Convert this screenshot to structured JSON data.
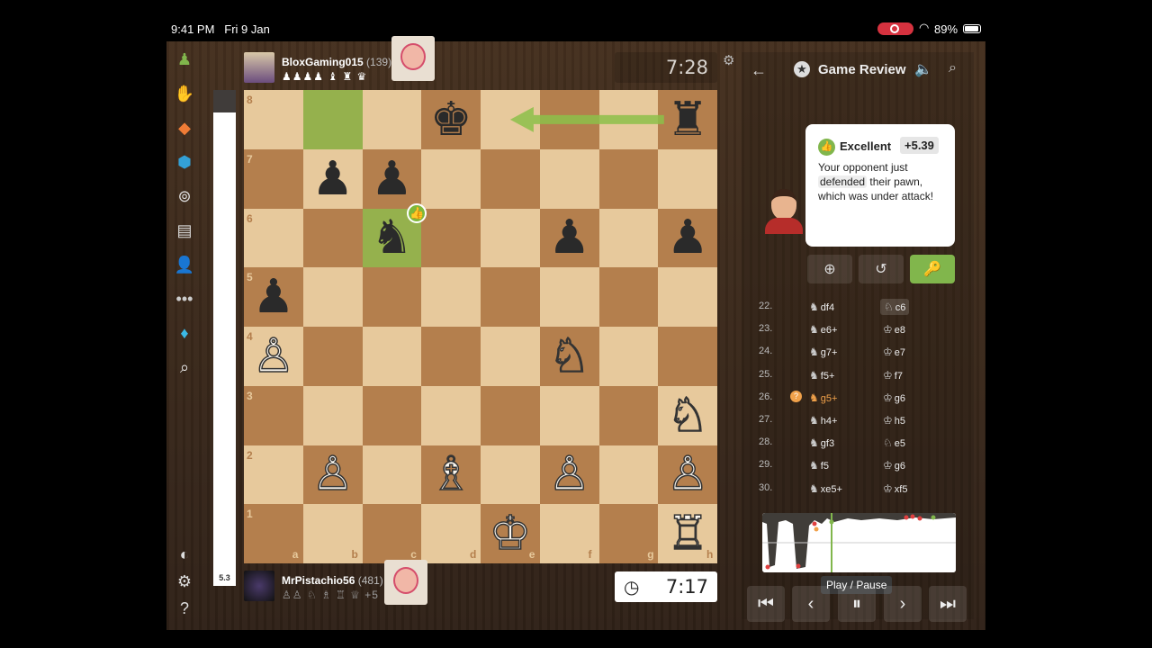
{
  "status_bar": {
    "time": "9:41 PM",
    "date": "Fri 9 Jan",
    "battery": "89%",
    "wifi": "wifi-icon"
  },
  "top_player": {
    "name": "BloxGaming015",
    "rating": "(139)",
    "captured": "♟♟♟♟ ♝ ♜ ♛",
    "clock": "7:28"
  },
  "bottom_player": {
    "name": "MrPistachio56",
    "rating": "(481)",
    "captured": "♙♙ ♘ ♗ ♖ ♕",
    "extra": "+5",
    "clock": "7:17"
  },
  "eval_bar": {
    "value": "5.3"
  },
  "board": {
    "files": [
      "a",
      "b",
      "c",
      "d",
      "e",
      "f",
      "g",
      "h"
    ],
    "ranks": [
      "8",
      "7",
      "6",
      "5",
      "4",
      "3",
      "2",
      "1"
    ],
    "pieces": [
      {
        "sq": "d8",
        "glyph": "♚",
        "color": "b"
      },
      {
        "sq": "h8",
        "glyph": "♜",
        "color": "b"
      },
      {
        "sq": "b7",
        "glyph": "♟",
        "color": "b"
      },
      {
        "sq": "c7",
        "glyph": "♟",
        "color": "b"
      },
      {
        "sq": "c6",
        "glyph": "♞",
        "color": "b"
      },
      {
        "sq": "f6",
        "glyph": "♟",
        "color": "b"
      },
      {
        "sq": "h6",
        "glyph": "♟",
        "color": "b"
      },
      {
        "sq": "a5",
        "glyph": "♟",
        "color": "b"
      },
      {
        "sq": "a4",
        "glyph": "♙",
        "color": "w"
      },
      {
        "sq": "f4",
        "glyph": "♘",
        "color": "w"
      },
      {
        "sq": "h3",
        "glyph": "♘",
        "color": "w"
      },
      {
        "sq": "b2",
        "glyph": "♙",
        "color": "w"
      },
      {
        "sq": "d2",
        "glyph": "♗",
        "color": "w"
      },
      {
        "sq": "f2",
        "glyph": "♙",
        "color": "w"
      },
      {
        "sq": "h2",
        "glyph": "♙",
        "color": "w"
      },
      {
        "sq": "e1",
        "glyph": "♔",
        "color": "w"
      },
      {
        "sq": "h1",
        "glyph": "♖",
        "color": "w"
      }
    ],
    "highlight": [
      "b8",
      "c6"
    ],
    "colors": {
      "light": "#e7c99c",
      "dark": "#b47f4d",
      "highlight": "#95b14d",
      "arrow": "#8cc04a"
    }
  },
  "review": {
    "header_title": "Game Review",
    "classification": "Excellent",
    "evaluation": "+5.39",
    "message_pre": "Your opponent just",
    "message_highlight": "defended",
    "message_post": "their pawn, which was under attack!",
    "tooltip": "Play / Pause"
  },
  "moves": [
    {
      "num": "22.",
      "w_piece": "♞",
      "w": "df4",
      "b_piece": "♘",
      "b": "c6",
      "current": true
    },
    {
      "num": "23.",
      "w_piece": "♞",
      "w": "e6+",
      "b_piece": "♔",
      "b": "e8"
    },
    {
      "num": "24.",
      "w_piece": "♞",
      "w": "g7+",
      "b_piece": "♔",
      "b": "e7"
    },
    {
      "num": "25.",
      "w_piece": "♞",
      "w": "f5+",
      "b_piece": "♔",
      "b": "f7"
    },
    {
      "num": "26.",
      "w_piece": "♞",
      "w": "g5+",
      "b_piece": "♔",
      "b": "g6",
      "mistake": true
    },
    {
      "num": "27.",
      "w_piece": "♞",
      "w": "h4+",
      "b_piece": "♔",
      "b": "h5"
    },
    {
      "num": "28.",
      "w_piece": "♞",
      "w": "gf3",
      "b_piece": "♘",
      "b": "e5"
    },
    {
      "num": "29.",
      "w_piece": "♞",
      "w": "f5",
      "b_piece": "♔",
      "b": "g6"
    },
    {
      "num": "30.",
      "w_piece": "♞",
      "w": "xe5+",
      "b_piece": "♔",
      "b": "xf5"
    }
  ]
}
